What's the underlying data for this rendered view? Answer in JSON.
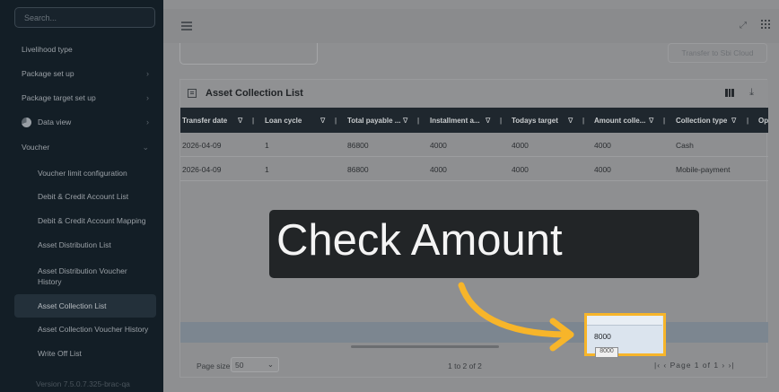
{
  "sidebar": {
    "search_placeholder": "Search...",
    "items": [
      {
        "label": "Livelihood type",
        "chevron": ""
      },
      {
        "label": "Package set up",
        "chevron": "›"
      },
      {
        "label": "Package target set up",
        "chevron": "›"
      },
      {
        "label": "Data view",
        "chevron": "›"
      },
      {
        "label": "Voucher",
        "chevron": "⌄"
      },
      {
        "label": "Voucher limit configuration"
      },
      {
        "label": "Debit & Credit Account List"
      },
      {
        "label": "Debit & Credit Account Mapping"
      },
      {
        "label": "Asset Distribution List"
      },
      {
        "label": "Asset Distribution Voucher History"
      },
      {
        "label": "Asset Collection List"
      },
      {
        "label": "Asset Collection Voucher History"
      },
      {
        "label": "Write Off List"
      }
    ],
    "version": "Version 7.5.0.7.325-brac-qa"
  },
  "topbar": {
    "expand_icon": "⤢"
  },
  "toolbar": {
    "sbi_button": "Transfer to Sbi Cloud"
  },
  "panel": {
    "title": "Asset Collection List",
    "columns": [
      "Transfer date",
      "Loan cycle",
      "Total payable ...",
      "Installment a...",
      "Todays target",
      "Amount colle...",
      "Collection type",
      "Op"
    ],
    "rows": [
      [
        "2026-04-09",
        "1",
        "86800",
        "4000",
        "4000",
        "4000",
        "Cash"
      ],
      [
        "2026-04-09",
        "1",
        "86800",
        "4000",
        "4000",
        "4000",
        "Mobile-payment"
      ]
    ],
    "filter_glyph": "∇",
    "sep": "|"
  },
  "pager": {
    "page_size_label": "Page size",
    "page_size": "50",
    "range": "1 to 2 of 2",
    "nav": "|‹  ‹   Page 1 of 1   ›  ›|"
  },
  "overlay": {
    "text": "Check Amount"
  },
  "highlight": {
    "value": "8000",
    "tooltip": "8000"
  },
  "colors": {
    "accent": "#f7b52a",
    "sidebar_bg": "#131e26"
  }
}
